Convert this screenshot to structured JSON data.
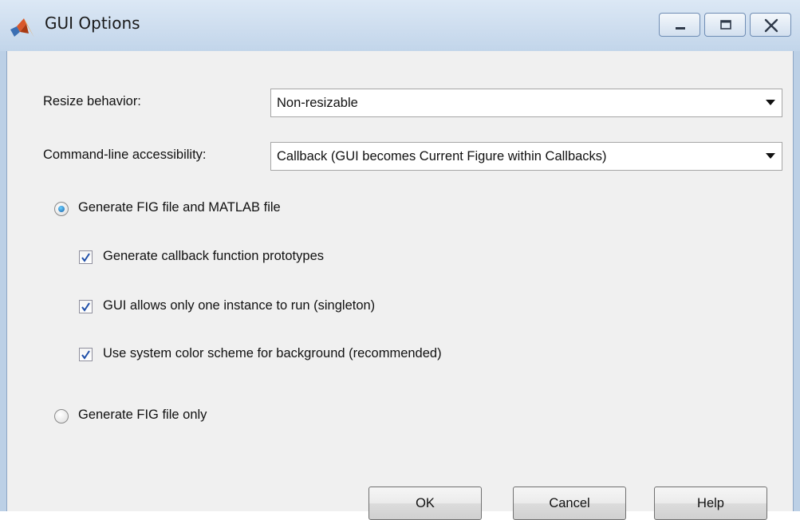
{
  "window": {
    "title": "GUI Options",
    "controls": {
      "minimize": "minimize-icon",
      "maximize": "maximize-icon",
      "close": "close-icon"
    }
  },
  "resize": {
    "label": "Resize behavior:",
    "selected": "Non-resizable"
  },
  "accessibility": {
    "label": "Command-line accessibility:",
    "selected": "Callback (GUI becomes Current Figure within Callbacks)"
  },
  "generate": {
    "fig_and_matlab": {
      "label": "Generate FIG file and MATLAB file",
      "selected": true
    },
    "options": [
      {
        "label": "Generate callback function prototypes",
        "checked": true
      },
      {
        "label": "GUI allows only one instance to run (singleton)",
        "checked": true
      },
      {
        "label": "Use system color scheme for background (recommended)",
        "checked": true
      }
    ],
    "fig_only": {
      "label": "Generate FIG file only",
      "selected": false
    }
  },
  "buttons": {
    "ok": "OK",
    "cancel": "Cancel",
    "help": "Help"
  },
  "colors": {
    "titlebar": "#c8d9ec",
    "dialog_bg": "#f0f0f0",
    "check_mark": "#1f4fa8",
    "radio_dot": "#1a5fa8"
  }
}
